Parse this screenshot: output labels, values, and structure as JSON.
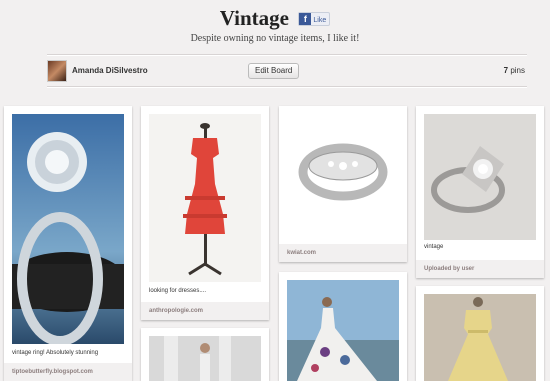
{
  "board": {
    "title": "Vintage",
    "like_label": "Like",
    "description": "Despite owning no vintage items, I like it!",
    "user_name": "Amanda DiSilvestro",
    "edit_label": "Edit Board",
    "pin_count": "7",
    "pin_count_label": "pins"
  },
  "pins": [
    {
      "caption": "vintage ring! Absolutely stunning",
      "source": "tiptoebutterfly.blogspot.com"
    },
    {
      "caption": "looking for dresses....",
      "source": "anthropologie.com"
    },
    {
      "caption": "",
      "source": "kwiat.com"
    },
    {
      "caption": "vintage",
      "source": "Uploaded by user"
    }
  ],
  "colors": {
    "background": "#f2f0f0",
    "facebook": "#3b5998"
  }
}
